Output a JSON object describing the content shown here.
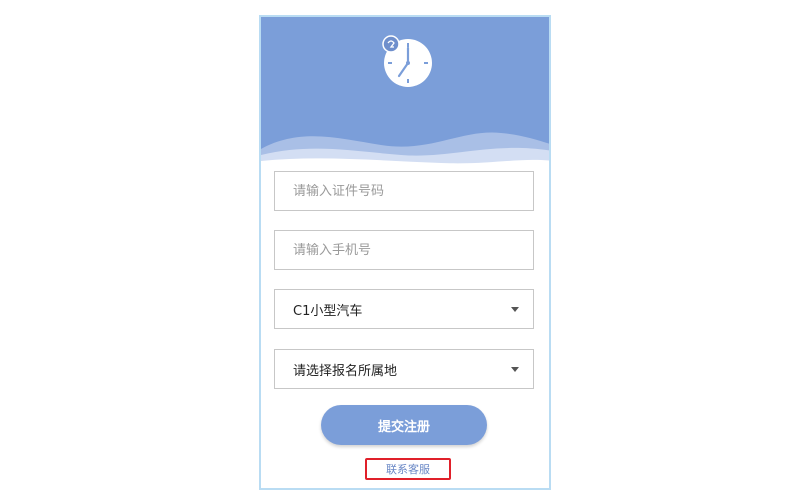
{
  "colors": {
    "header_bg": "#7b9ed9",
    "button_bg": "#7b9ed9",
    "contact_highlight": "#e0202a",
    "link_text": "#6a88c6"
  },
  "header": {
    "icon": "clock-icon",
    "badge_icon": "badge-icon"
  },
  "form": {
    "id_number": {
      "placeholder": "请输入证件号码",
      "value": ""
    },
    "phone": {
      "placeholder": "请输入手机号",
      "value": ""
    },
    "license_type": {
      "selected": "C1小型汽车",
      "icon": "chevron-down-icon"
    },
    "location": {
      "selected": "请选择报名所属地",
      "icon": "chevron-down-icon"
    },
    "submit_label": "提交注册"
  },
  "contact_link": "联系客服"
}
